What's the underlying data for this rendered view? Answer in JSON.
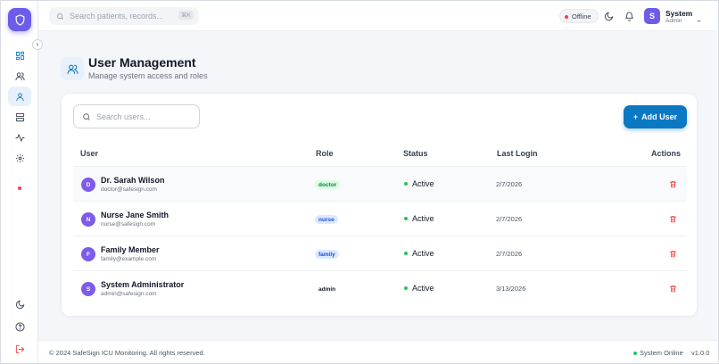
{
  "topbar": {
    "search_placeholder": "Search patients, records...",
    "search_shortcut": "⌘K",
    "offline_label": "Offline",
    "user_name": "System",
    "user_role": "Admin",
    "user_initial": "S"
  },
  "sidebar": {
    "nav_items": [
      "dashboard-icon",
      "users-icon",
      "user-icon",
      "server-icon",
      "activity-icon",
      "settings-icon"
    ],
    "active_item": "user-icon",
    "bottom_items": [
      "moon-icon",
      "help-icon",
      "logout-icon"
    ]
  },
  "page": {
    "title": "User Management",
    "subtitle": "Manage system access and roles"
  },
  "toolbar": {
    "search_placeholder": "Search users...",
    "add_label": "Add User"
  },
  "table": {
    "headers": {
      "user": "User",
      "role": "Role",
      "status": "Status",
      "last_login": "Last Login",
      "actions": "Actions"
    },
    "rows": [
      {
        "initial": "D",
        "name": "Dr. Sarah Wilson",
        "email": "doctor@safesign.com",
        "role": "doctor",
        "status": "Active",
        "last_login": "2/7/2026"
      },
      {
        "initial": "N",
        "name": "Nurse Jane Smith",
        "email": "nurse@safesign.com",
        "role": "nurse",
        "status": "Active",
        "last_login": "2/7/2026"
      },
      {
        "initial": "F",
        "name": "Family Member",
        "email": "family@example.com",
        "role": "family",
        "status": "Active",
        "last_login": "2/7/2026"
      },
      {
        "initial": "S",
        "name": "System Administrator",
        "email": "admin@safesign.com",
        "role": "admin",
        "status": "Active",
        "last_login": "3/13/2026"
      }
    ]
  },
  "footer": {
    "copyright": "© 2024 SafeSign ICU Monitoring. All rights reserved.",
    "status": "System Online",
    "version": "v1.0.0"
  },
  "colors": {
    "brand": "#6d5ce8",
    "primary_button": "#0a78c2",
    "active_status": "#22c55e",
    "offline_dot": "#ef4444",
    "delete_icon": "#ef4444",
    "role_doctor_bg": "#dcfce7",
    "role_nurse_bg": "#dbeafe",
    "role_family_bg": "#dbeafe"
  }
}
